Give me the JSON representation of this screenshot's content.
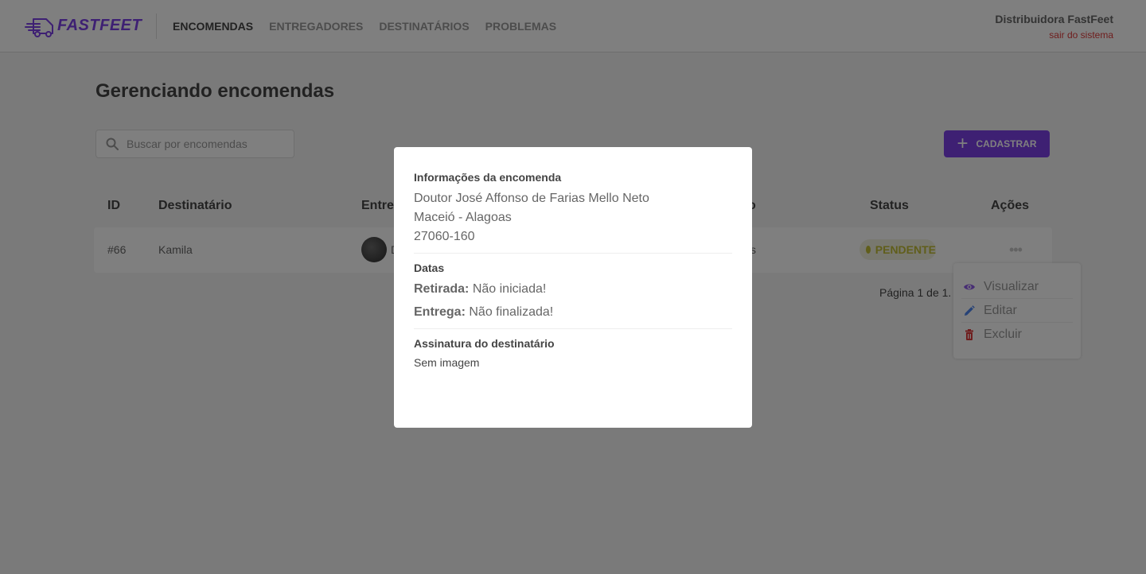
{
  "header": {
    "logo_text": "FASTFEET",
    "nav": [
      {
        "label": "ENCOMENDAS",
        "active": true
      },
      {
        "label": "ENTREGADORES",
        "active": false
      },
      {
        "label": "DESTINATÁRIOS",
        "active": false
      },
      {
        "label": "PROBLEMAS",
        "active": false
      }
    ],
    "user_name": "Distribuidora FastFeet",
    "logout_label": "sair do sistema"
  },
  "main": {
    "title": "Gerenciando encomendas",
    "search_placeholder": "Buscar por encomendas",
    "add_button_label": "CADASTRAR",
    "columns": [
      "ID",
      "Destinatário",
      "Entreg",
      "o",
      "Status",
      "Ações"
    ],
    "rows": [
      {
        "id": "#66",
        "recipient": "Kamila",
        "courier_partial": "D",
        "city_partial": "s",
        "status": "PENDENTE"
      }
    ],
    "pagination": "Página 1 de 1."
  },
  "dropdown": {
    "items": [
      {
        "label": "Visualizar",
        "icon": "eye-icon"
      },
      {
        "label": "Editar",
        "icon": "pencil-icon"
      },
      {
        "label": "Excluir",
        "icon": "trash-icon"
      }
    ]
  },
  "modal": {
    "info_title": "Informações da encomenda",
    "street": "Doutor José Affonso de Farias Mello Neto",
    "city_state": "Maceió - Alagoas",
    "zip": "27060-160",
    "dates_title": "Datas",
    "pickup_label": "Retirada:",
    "pickup_value": "Não iniciada!",
    "delivery_label": "Entrega:",
    "delivery_value": "Não finalizada!",
    "signature_title": "Assinatura do destinatário",
    "signature_value": "Sem imagem"
  },
  "colors": {
    "brand": "#7d40e7",
    "pending_bg": "#f0f0df",
    "pending_text": "#c1bc35",
    "logout": "#de3b3b",
    "edit_icon": "#4d85ee",
    "delete_icon": "#de3b3b"
  }
}
